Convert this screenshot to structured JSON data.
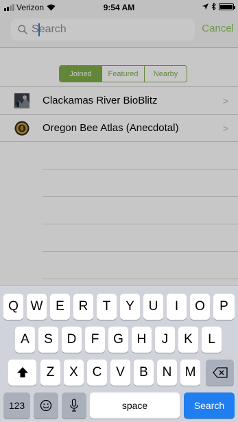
{
  "status": {
    "carrier": "Verizon",
    "time": "9:54 AM"
  },
  "search": {
    "placeholder": "Search",
    "value": "",
    "cancel_label": "Cancel"
  },
  "tabs": [
    {
      "label": "Joined",
      "active": true
    },
    {
      "label": "Featured",
      "active": false
    },
    {
      "label": "Nearby",
      "active": false
    }
  ],
  "projects": [
    {
      "name": "Clackamas River BioBlitz",
      "icon": "project-photo-icon"
    },
    {
      "name": "Oregon Bee Atlas (Anecdotal)",
      "icon": "bee-atlas-logo-icon"
    }
  ],
  "keyboard": {
    "row1": [
      "Q",
      "W",
      "E",
      "R",
      "T",
      "Y",
      "U",
      "I",
      "O",
      "P"
    ],
    "row2": [
      "A",
      "S",
      "D",
      "F",
      "G",
      "H",
      "J",
      "K",
      "L"
    ],
    "row3": [
      "Z",
      "X",
      "C",
      "V",
      "B",
      "N",
      "M"
    ],
    "numbers_label": "123",
    "space_label": "space",
    "search_label": "Search"
  },
  "colors": {
    "accent": "#7fae4a",
    "cancel": "#8cbf5a",
    "search_key": "#1f7ef0"
  }
}
